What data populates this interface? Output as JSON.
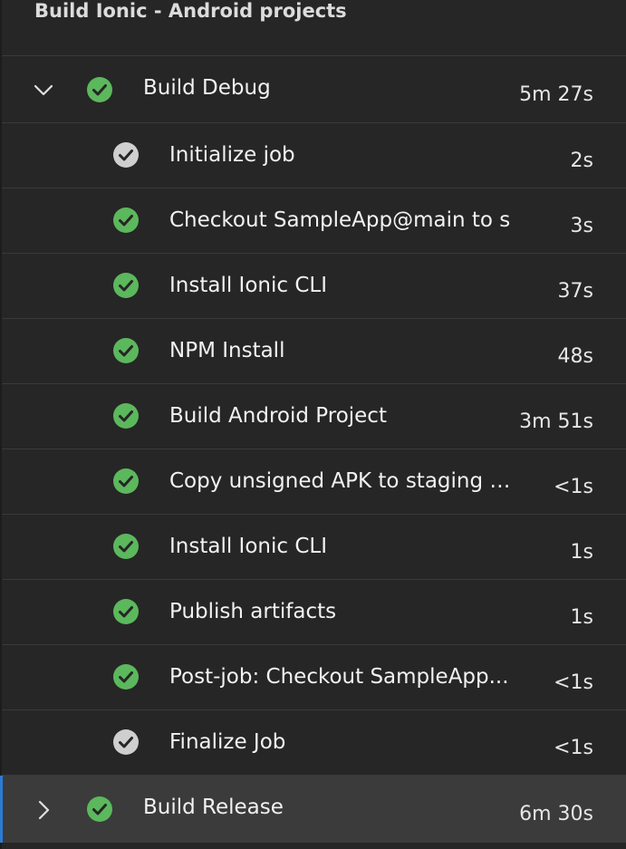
{
  "header": {
    "title": "Build Ionic - Android projects"
  },
  "colors": {
    "success": "#5cb85c",
    "neutral": "#cfcfcf",
    "selection_accent": "#2b7bd6"
  },
  "jobs": [
    {
      "name": "Build Debug",
      "duration": "5m 27s",
      "status": "success",
      "expanded": true,
      "icon": "chevron-down-icon",
      "steps": [
        {
          "name": "Initialize job",
          "duration": "2s",
          "status": "neutral"
        },
        {
          "name": "Checkout SampleApp@main to s",
          "duration": "3s",
          "status": "success"
        },
        {
          "name": "Install Ionic CLI",
          "duration": "37s",
          "status": "success"
        },
        {
          "name": "NPM Install",
          "duration": "48s",
          "status": "success"
        },
        {
          "name": "Build Android Project",
          "duration": "3m 51s",
          "status": "success"
        },
        {
          "name": "Copy unsigned APK to staging d...",
          "duration": "<1s",
          "status": "success"
        },
        {
          "name": "Install Ionic CLI",
          "duration": "1s",
          "status": "success"
        },
        {
          "name": "Publish artifacts",
          "duration": "1s",
          "status": "success"
        },
        {
          "name": "Post-job: Checkout SampleApp...",
          "duration": "<1s",
          "status": "success"
        },
        {
          "name": "Finalize Job",
          "duration": "<1s",
          "status": "neutral"
        }
      ]
    },
    {
      "name": "Build Release",
      "duration": "6m 30s",
      "status": "success",
      "expanded": false,
      "icon": "chevron-right-icon",
      "steps": []
    }
  ]
}
